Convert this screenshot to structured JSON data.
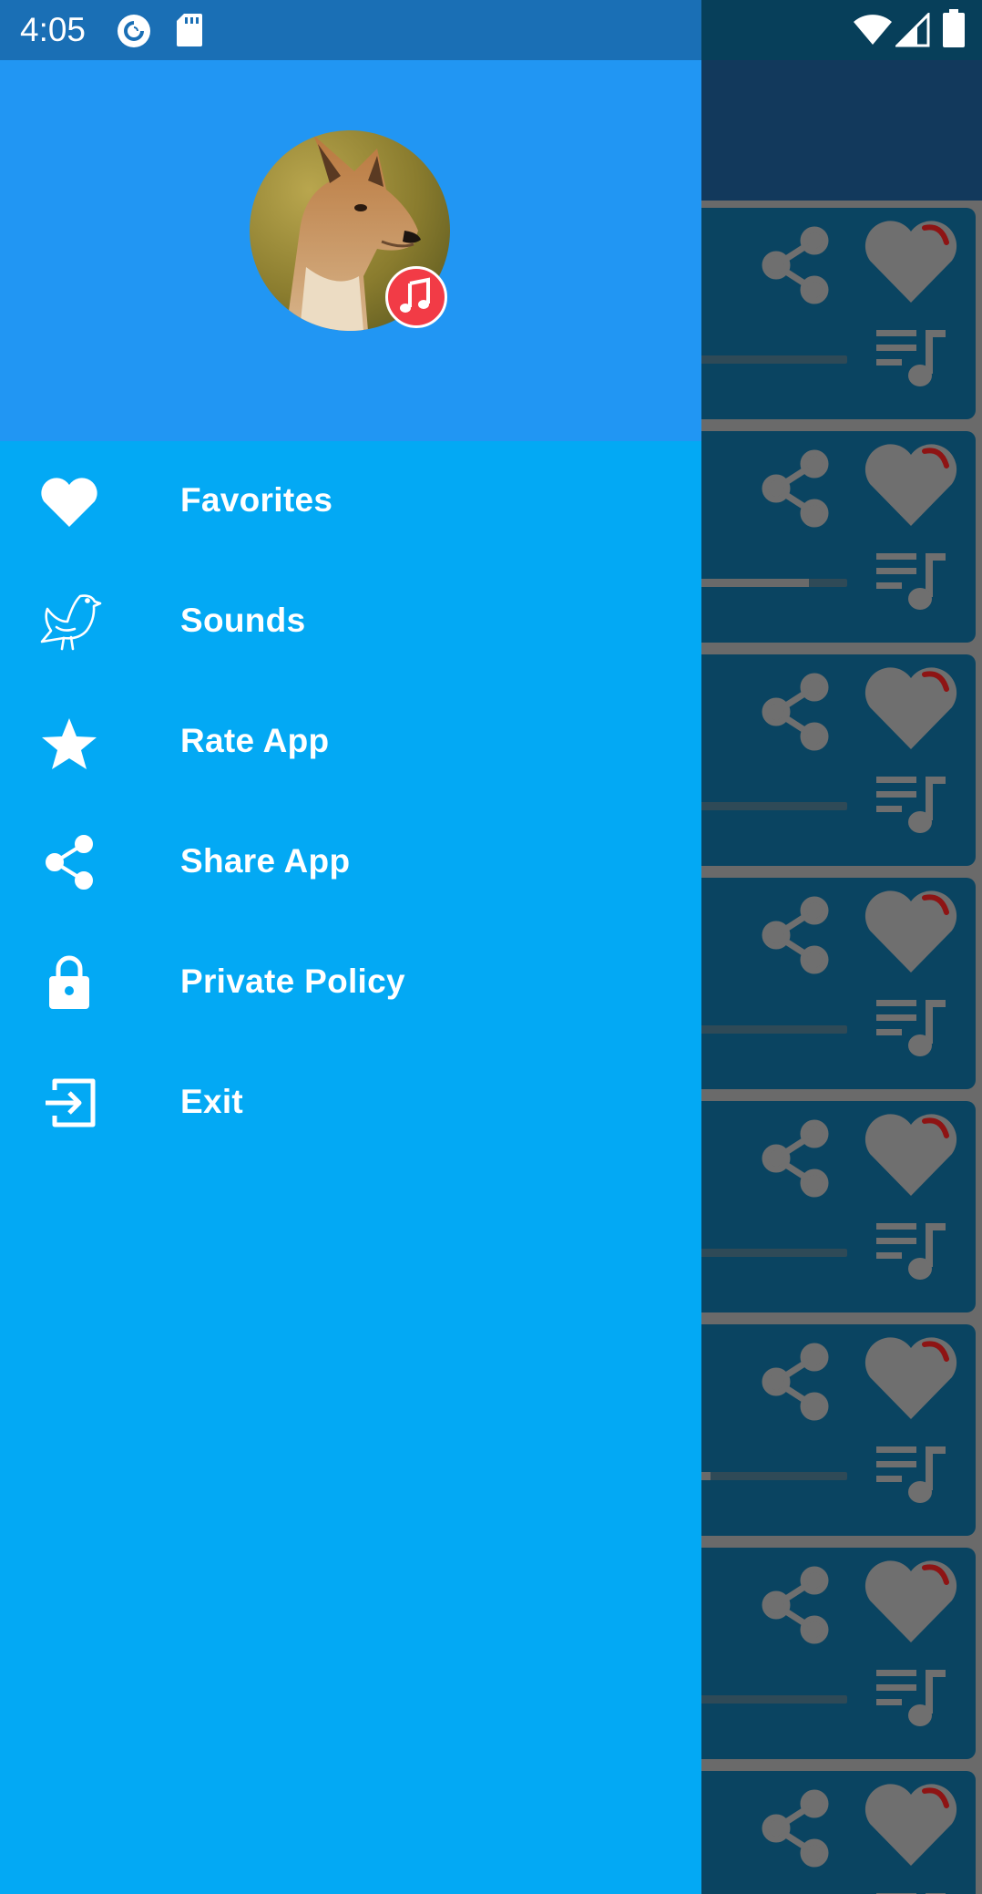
{
  "status_bar": {
    "time": "4:05",
    "icons": [
      "pocket-casts-icon",
      "sd-card-icon",
      "wifi-icon",
      "cell-signal-icon",
      "battery-icon"
    ]
  },
  "drawer": {
    "header": {
      "avatar": "jackal-photo",
      "badge_icon": "music-note-icon"
    },
    "items": [
      {
        "label": "Favorites",
        "icon": "heart-icon"
      },
      {
        "label": "Sounds",
        "icon": "bird-icon"
      },
      {
        "label": "Rate App",
        "icon": "star-icon"
      },
      {
        "label": "Share App",
        "icon": "share-icon"
      },
      {
        "label": "Private Policy",
        "icon": "lock-icon"
      },
      {
        "label": "Exit",
        "icon": "exit-icon"
      }
    ]
  },
  "background_list": {
    "progress": [
      0,
      0.75,
      0,
      0,
      0,
      0.12,
      0,
      0
    ],
    "card_icons": [
      "share-icon",
      "heart-icon",
      "playlist-add-icon"
    ]
  },
  "colors": {
    "drawer_header": "#2196f3",
    "drawer_body": "#03a9f4",
    "status_bar": "#1a6fb5",
    "badge": "#f23b46"
  }
}
